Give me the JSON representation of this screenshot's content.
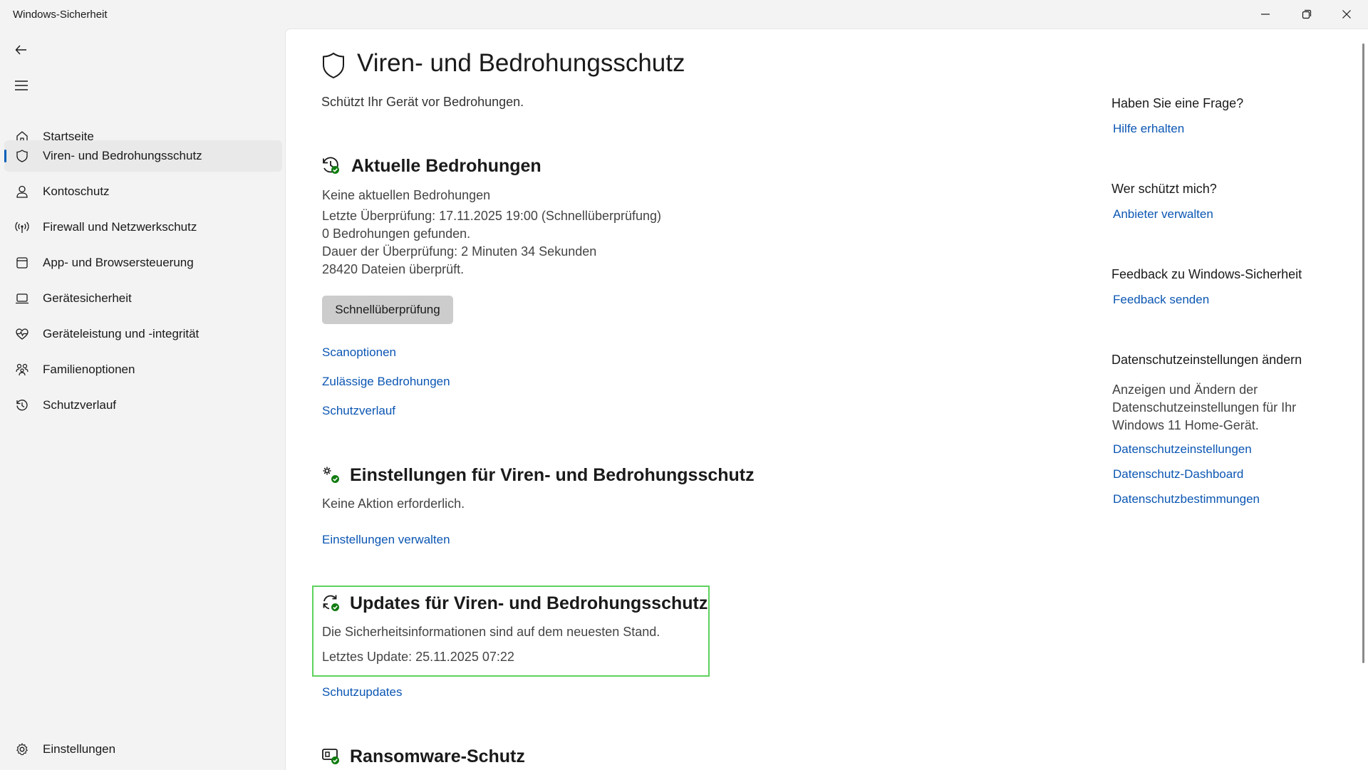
{
  "window": {
    "title": "Windows-Sicherheit"
  },
  "sidebar": {
    "items": [
      {
        "label": "Startseite",
        "icon": "home-icon"
      },
      {
        "label": "Viren- und Bedrohungsschutz",
        "icon": "shield-icon",
        "active": true
      },
      {
        "label": "Kontoschutz",
        "icon": "person-icon"
      },
      {
        "label": "Firewall und Netzwerkschutz",
        "icon": "antenna-icon"
      },
      {
        "label": "App- und Browsersteuerung",
        "icon": "app-window-icon"
      },
      {
        "label": "Gerätesicherheit",
        "icon": "laptop-icon"
      },
      {
        "label": "Geräteleistung und -integrität",
        "icon": "heart-pulse-icon"
      },
      {
        "label": "Familienoptionen",
        "icon": "family-icon"
      },
      {
        "label": "Schutzverlauf",
        "icon": "history-icon"
      }
    ],
    "settings_label": "Einstellungen"
  },
  "main": {
    "title": "Viren- und Bedrohungsschutz",
    "subtitle": "Schützt Ihr Gerät vor Bedrohungen.",
    "current_threats": {
      "title": "Aktuelle Bedrohungen",
      "lines": [
        "Keine aktuellen Bedrohungen",
        "Letzte Überprüfung: 17.11.2025 19:00 (Schnellüberprüfung)",
        "0 Bedrohungen gefunden.",
        "Dauer der Überprüfung: 2 Minuten 34 Sekunden",
        "28420 Dateien überprüft."
      ],
      "button": "Schnellüberprüfung",
      "links": [
        "Scanoptionen",
        "Zulässige Bedrohungen",
        "Schutzverlauf"
      ]
    },
    "settings": {
      "title": "Einstellungen für Viren- und Bedrohungsschutz",
      "text": "Keine Aktion erforderlich.",
      "link": "Einstellungen verwalten"
    },
    "updates": {
      "title": "Updates für Viren- und Bedrohungsschutz",
      "text": "Die Sicherheitsinformationen sind auf dem neuesten Stand.",
      "last_update": "Letztes Update: 25.11.2025 07:22",
      "link": "Schutzupdates"
    },
    "ransomware": {
      "title": "Ransomware-Schutz"
    }
  },
  "right": {
    "question": {
      "heading": "Haben Sie eine Frage?",
      "link": "Hilfe erhalten"
    },
    "protector": {
      "heading": "Wer schützt mich?",
      "link": "Anbieter verwalten"
    },
    "feedback": {
      "heading": "Feedback zu Windows-Sicherheit",
      "link": "Feedback senden"
    },
    "privacy": {
      "heading": "Datenschutzeinstellungen ändern",
      "text": "Anzeigen und Ändern der Datenschutzeinstellungen für Ihr Windows 11 Home-Gerät.",
      "links": [
        "Datenschutzeinstellungen",
        "Datenschutz-Dashboard",
        "Datenschutzbestimmungen"
      ]
    }
  },
  "colors": {
    "accent": "#005fb8",
    "link": "#0b56b3",
    "ok_green": "#107c10",
    "highlight": "#5ed25e"
  }
}
